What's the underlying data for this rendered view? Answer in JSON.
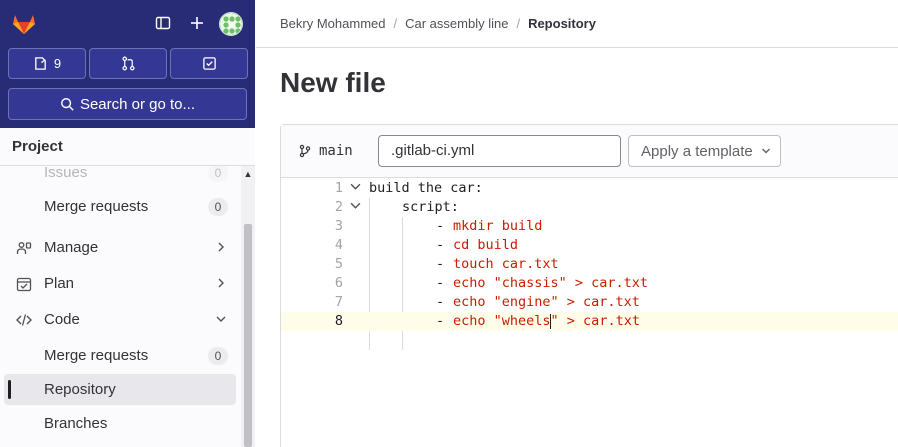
{
  "sidebar": {
    "issues_count": "9",
    "search_placeholder": "Search or go to...",
    "section_title": "Project",
    "items": [
      {
        "label": "Issues",
        "badge": "0"
      },
      {
        "label": "Merge requests",
        "badge": "0"
      },
      {
        "label": "Manage"
      },
      {
        "label": "Plan"
      },
      {
        "label": "Code"
      },
      {
        "label": "Merge requests",
        "badge": "0"
      },
      {
        "label": "Repository"
      },
      {
        "label": "Branches"
      }
    ]
  },
  "breadcrumb": {
    "user": "Bekry Mohammed",
    "project": "Car assembly line",
    "current": "Repository"
  },
  "page": {
    "title": "New file",
    "branch": "main",
    "filename": ".gitlab-ci.yml",
    "template_button": "Apply a template"
  },
  "code": {
    "lines": [
      {
        "n": "1",
        "text": "build the car:"
      },
      {
        "n": "2",
        "text": "script:"
      },
      {
        "n": "3",
        "dash": "- ",
        "text": "mkdir build"
      },
      {
        "n": "4",
        "dash": "- ",
        "text": "cd build"
      },
      {
        "n": "5",
        "dash": "- ",
        "text": "touch car.txt"
      },
      {
        "n": "6",
        "dash": "- ",
        "text": "echo \"chassis\" > car.txt"
      },
      {
        "n": "7",
        "dash": "- ",
        "text": "echo \"engine\" > car.txt"
      },
      {
        "n": "8",
        "dash": "- ",
        "text_a": "echo \"wheels",
        "text_b": "\" > car.txt"
      }
    ]
  },
  "colors": {
    "sidebar_top": "#282c77",
    "code_red": "#c91c00",
    "current_line": "#fefde9"
  }
}
